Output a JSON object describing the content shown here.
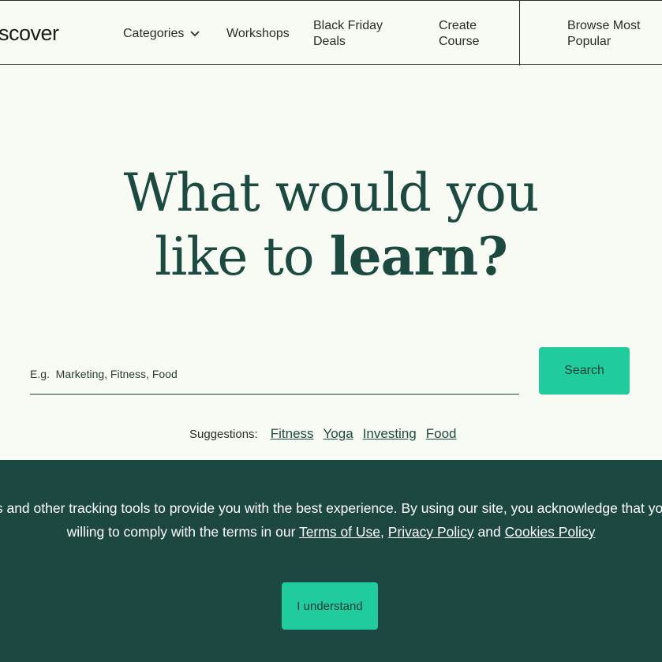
{
  "header": {
    "logo_text": "scover",
    "nav": {
      "categories": "Categories",
      "workshops": "Workshops",
      "black_friday": "Black Friday Deals",
      "create_course": "Create Course",
      "browse_popular": "Browse Most Popular"
    }
  },
  "hero": {
    "title_line1": "What would you",
    "title_line2_prefix": "like to ",
    "title_line2_bold": "learn?"
  },
  "search": {
    "placeholder": "E.g.  Marketing, Fitness, Food",
    "button_label": "Search"
  },
  "suggestions": {
    "label": "Suggestions:",
    "items": [
      "Fitness",
      "Yoga",
      "Investing",
      "Food"
    ]
  },
  "cookie": {
    "text_part1": "This website uses cookies and other tracking tools to provide you with the best experience. By using our site, you acknowledge that you understand this and are willing to comply with the terms in our ",
    "terms_link": "Terms of Use",
    "sep": ", ",
    "privacy_link": "Privacy Policy",
    "and": " and ",
    "cookies_link": "Cookies Policy",
    "button_label": "I understand"
  },
  "colors": {
    "accent": "#20cc9c",
    "banner_bg": "#1d4741",
    "page_bg": "#f7fbf4",
    "heading": "#1d4a40"
  }
}
